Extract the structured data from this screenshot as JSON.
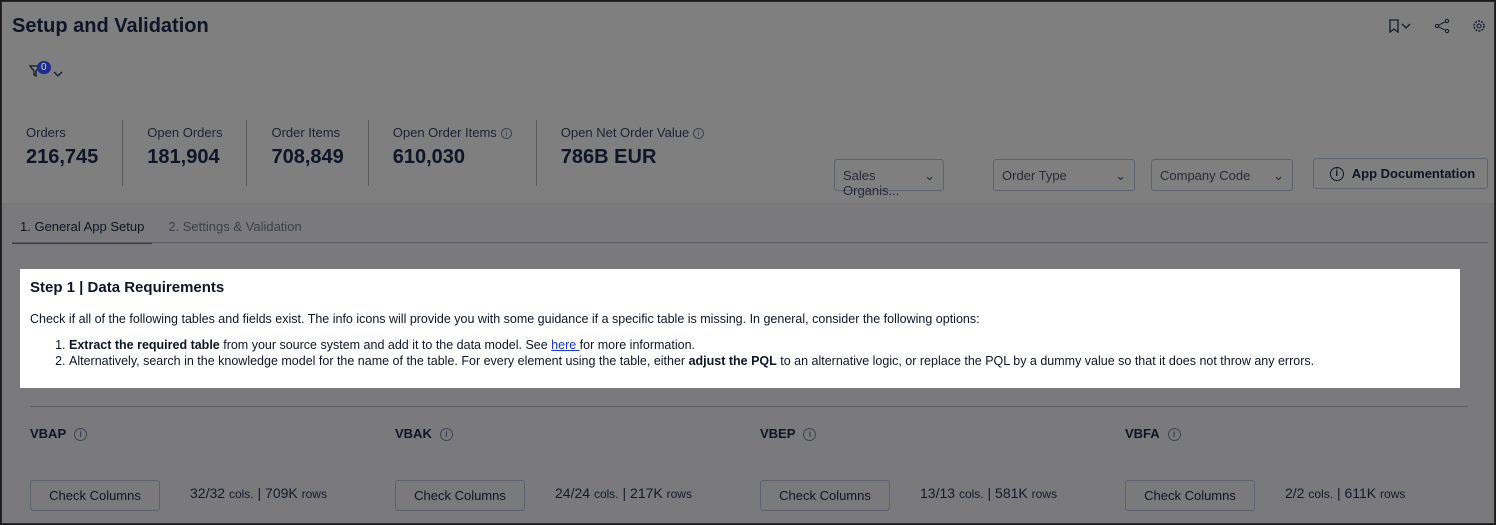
{
  "header": {
    "title": "Setup and Validation",
    "filter_count": "0"
  },
  "kpis": [
    {
      "label": "Orders",
      "value": "216,745",
      "info": false
    },
    {
      "label": "Open Orders",
      "value": "181,904",
      "info": false
    },
    {
      "label": "Order Items",
      "value": "708,849",
      "info": false
    },
    {
      "label": "Open Order Items",
      "value": "610,030",
      "info": true
    },
    {
      "label": "Open Net Order Value",
      "value": "786B EUR",
      "info": true
    }
  ],
  "dropdowns": [
    "Sales Organis...",
    "Order Type",
    "Company Code"
  ],
  "doc_button": "App Documentation",
  "tabs": [
    "1. General App Setup",
    "2. Settings & Validation"
  ],
  "step": {
    "title": "Step 1 | Data Requirements",
    "intro": "Check if all of the following tables and fields exist. The info icons will provide you with some guidance if a specific table is missing. In general, consider the following options:",
    "item1_bold": "Extract the required table",
    "item1_a": " from your source system and add it to the data model. See ",
    "item1_link": "here ",
    "item1_b": "for more information.",
    "item2_a": "Alternatively, search in the knowledge model for the name of the table. For every element using the table, either ",
    "item2_bold": "adjust the PQL",
    "item2_b": " to an alternative logic, or replace the PQL by a dummy value so that it does not throw any errors."
  },
  "check_label": "Check Columns",
  "tables": [
    {
      "name": "VBAP",
      "cols": "32/32",
      "rows": "709K"
    },
    {
      "name": "VBAK",
      "cols": "24/24",
      "rows": "217K"
    },
    {
      "name": "VBEP",
      "cols": "13/13",
      "rows": "581K"
    },
    {
      "name": "VBFA",
      "cols": "2/2",
      "rows": "611K"
    }
  ],
  "units": {
    "cols": "cols.",
    "sep": "|",
    "rows": "rows"
  }
}
